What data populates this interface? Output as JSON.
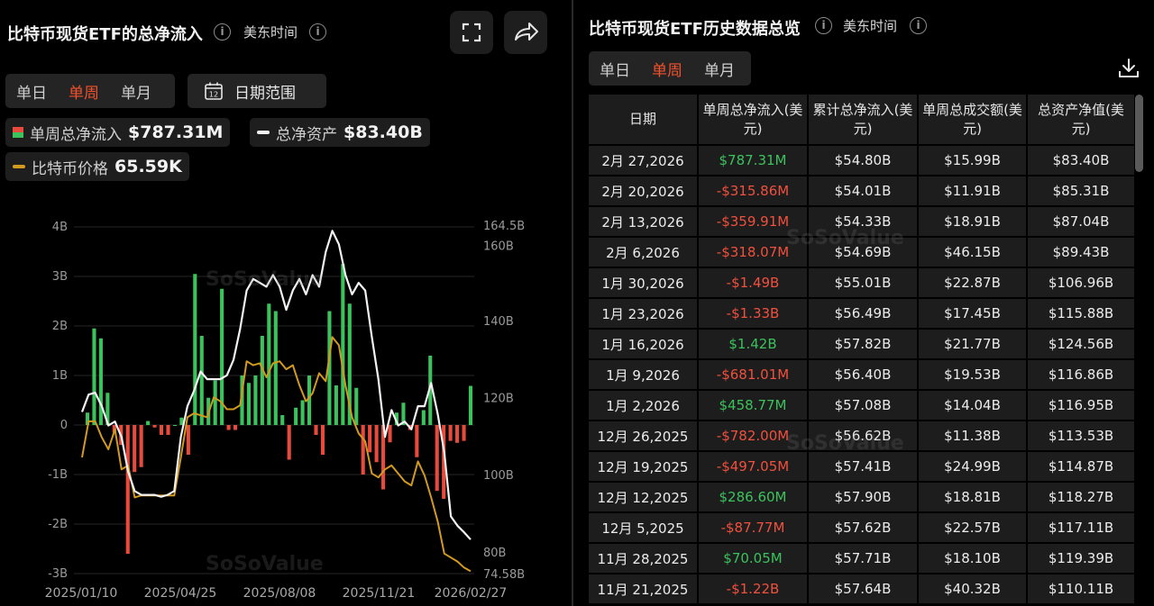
{
  "left": {
    "title": "比特币现货ETF的总净流入",
    "timezone": "美东时间",
    "period_tabs": [
      {
        "label": "单日",
        "active": false
      },
      {
        "label": "单周",
        "active": true
      },
      {
        "label": "单月",
        "active": false
      }
    ],
    "date_range_label": "日期范围",
    "date_range_icon_text": "12",
    "legend": {
      "flow": {
        "label": "单周总净流入",
        "value": "$787.31M"
      },
      "assets": {
        "label": "总净资产",
        "value": "$83.40B"
      },
      "price": {
        "label": "比特币价格",
        "value": "65.59K"
      }
    },
    "watermark": "SoSoValue"
  },
  "right": {
    "title": "比特币现货ETF历史数据总览",
    "timezone": "美东时间",
    "period_tabs": [
      {
        "label": "单日",
        "active": false
      },
      {
        "label": "单周",
        "active": true
      },
      {
        "label": "单月",
        "active": false
      }
    ],
    "columns": [
      "日期",
      "单周总净流入(美元)",
      "累计总净流入(美元)",
      "单周总成交额(美元)",
      "总资产净值(美元)"
    ],
    "rows": [
      {
        "date": "2月 27,2026",
        "flow": "$787.31M",
        "cum": "$54.80B",
        "vol": "$15.99B",
        "nav": "$83.40B"
      },
      {
        "date": "2月 20,2026",
        "flow": "-$315.86M",
        "cum": "$54.01B",
        "vol": "$11.91B",
        "nav": "$85.31B"
      },
      {
        "date": "2月 13,2026",
        "flow": "-$359.91M",
        "cum": "$54.33B",
        "vol": "$18.91B",
        "nav": "$87.04B"
      },
      {
        "date": "2月 6,2026",
        "flow": "-$318.07M",
        "cum": "$54.69B",
        "vol": "$46.15B",
        "nav": "$89.43B"
      },
      {
        "date": "1月 30,2026",
        "flow": "-$1.49B",
        "cum": "$55.01B",
        "vol": "$22.87B",
        "nav": "$106.96B"
      },
      {
        "date": "1月 23,2026",
        "flow": "-$1.33B",
        "cum": "$56.49B",
        "vol": "$17.45B",
        "nav": "$115.88B"
      },
      {
        "date": "1月 16,2026",
        "flow": "$1.42B",
        "cum": "$57.82B",
        "vol": "$21.77B",
        "nav": "$124.56B"
      },
      {
        "date": "1月 9,2026",
        "flow": "-$681.01M",
        "cum": "$56.40B",
        "vol": "$19.53B",
        "nav": "$116.86B"
      },
      {
        "date": "1月 2,2026",
        "flow": "$458.77M",
        "cum": "$57.08B",
        "vol": "$14.04B",
        "nav": "$116.95B"
      },
      {
        "date": "12月 26,2025",
        "flow": "-$782.00M",
        "cum": "$56.62B",
        "vol": "$11.38B",
        "nav": "$113.53B"
      },
      {
        "date": "12月 19,2025",
        "flow": "-$497.05M",
        "cum": "$57.41B",
        "vol": "$24.99B",
        "nav": "$114.87B"
      },
      {
        "date": "12月 12,2025",
        "flow": "$286.60M",
        "cum": "$57.90B",
        "vol": "$18.81B",
        "nav": "$118.27B"
      },
      {
        "date": "12月 5,2025",
        "flow": "-$87.77M",
        "cum": "$57.62B",
        "vol": "$22.57B",
        "nav": "$117.11B"
      },
      {
        "date": "11月 28,2025",
        "flow": "$70.05M",
        "cum": "$57.71B",
        "vol": "$18.10B",
        "nav": "$119.39B"
      },
      {
        "date": "11月 21,2025",
        "flow": "-$1.22B",
        "cum": "$57.64B",
        "vol": "$40.32B",
        "nav": "$110.11B"
      }
    ],
    "watermark": "SoSoValue"
  },
  "colors": {
    "positive": "#3cc25d",
    "negative": "#e84a3c",
    "assets_line": "#f2f2f2",
    "price_line": "#d29a1e",
    "active_tab": "#f0522d"
  },
  "icons": [
    "info-icon",
    "fullscreen-icon",
    "share-icon",
    "calendar-icon",
    "download-icon"
  ],
  "chart_data": {
    "type": "bar",
    "x_ticks": [
      "2025/01/10",
      "2025/04/25",
      "2025/08/08",
      "2025/11/21",
      "2026/02/27"
    ],
    "y_left_ticks": [
      "4B",
      "3B",
      "2B",
      "1B",
      "0",
      "-1B",
      "-2B",
      "-3B"
    ],
    "y_left_range": [
      -3,
      4
    ],
    "y_right_ticks": [
      "164.5B",
      "160B",
      "140B",
      "120B",
      "100B",
      "80B",
      "74.58B"
    ],
    "y_right_range": [
      74.58,
      164.5
    ],
    "grid": true,
    "series": [
      {
        "name": "单周总净流入",
        "unit": "B USD",
        "values": [
          0.25,
          1.95,
          1.75,
          0.65,
          -0.15,
          -0.4,
          -2.6,
          -0.95,
          -0.85,
          0.08,
          -0.05,
          -0.2,
          -0.2,
          0.0,
          0.15,
          -0.6,
          3.05,
          1.8,
          0.55,
          0.9,
          2.75,
          -0.1,
          -0.1,
          1.0,
          0.85,
          1.0,
          1.8,
          2.45,
          2.3,
          0.2,
          -0.7,
          0.35,
          0.5,
          1.0,
          -0.2,
          -0.6,
          2.3,
          0.8,
          3.25,
          2.45,
          0.75,
          -1.0,
          -0.55,
          -0.75,
          -1.3,
          -0.35,
          0.25,
          0.45,
          -0.1,
          -0.65,
          0.3,
          1.4,
          -1.33,
          -1.49,
          -0.32,
          -0.36,
          -0.32,
          0.79
        ]
      },
      {
        "name": "总净资产",
        "unit": "B USD",
        "values": [
          116.5,
          121,
          121.5,
          118,
          113,
          114,
          110,
          101,
          96,
          95,
          95,
          95,
          94.5,
          95,
          96,
          110,
          118,
          122,
          127,
          125,
          125,
          125,
          126,
          130,
          138,
          148,
          151,
          150,
          149,
          152,
          149,
          143,
          148,
          151,
          147,
          152,
          149,
          158,
          163.5,
          160,
          152,
          147,
          150,
          148,
          136,
          125,
          110,
          117,
          113,
          114,
          112,
          118,
          118,
          124,
          116,
          106,
          89.4,
          87,
          85.3,
          83.4
        ]
      },
      {
        "name": "比特币价格",
        "unit": "K USD",
        "values": [
          94,
          103,
          103,
          99,
          96,
          101,
          91,
          92,
          84,
          84.5,
          84.5,
          84.5,
          84.5,
          84.5,
          84.5,
          94,
          104,
          105,
          104.5,
          104,
          109,
          108,
          106,
          106,
          107,
          118,
          117,
          117.5,
          114,
          117.5,
          118,
          116,
          117,
          112,
          108,
          110,
          115,
          113,
          124,
          122,
          112,
          104,
          100,
          98,
          90,
          89,
          91,
          92,
          90,
          88,
          87,
          93,
          89.5,
          84,
          78,
          70,
          69,
          68,
          66.5,
          65.59
        ]
      }
    ]
  }
}
